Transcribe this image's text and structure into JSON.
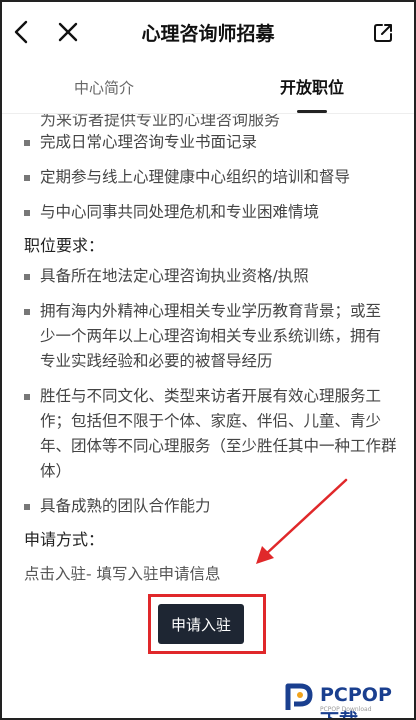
{
  "navbar": {
    "title": "心理咨询师招募"
  },
  "tabs": [
    {
      "label": "中心简介",
      "active": false
    },
    {
      "label": "开放职位",
      "active": true
    }
  ],
  "duties_partial": "为来访者提供专业的心理咨询服务",
  "duties": [
    "完成日常心理咨询专业书面记录",
    "定期参与线上心理健康中心组织的培训和督导",
    "与中心同事共同处理危机和专业困难情境"
  ],
  "requirements": {
    "title": "职位要求：",
    "items": [
      "具备所在地法定心理咨询执业资格/执照",
      "拥有海内外精神心理相关专业学历教育背景；或至少一个两年以上心理咨询相关专业系统训练，拥有专业实践经验和必要的被督导经历",
      "胜任与不同文化、类型来访者开展有效心理服务工作；包括但不限于个体、家庭、伴侣、儿童、青少年、团体等不同心理服务（至少胜任其中一种工作群体）",
      "具备成熟的团队合作能力"
    ]
  },
  "apply": {
    "title": "申请方式：",
    "text": "点击入驻- 填写入驻申请信息",
    "button_label": "申请入驻"
  },
  "annotation_color": "#e0282a",
  "watermark": {
    "text": "PCPOP下载",
    "sub": "PCPOP Download"
  }
}
